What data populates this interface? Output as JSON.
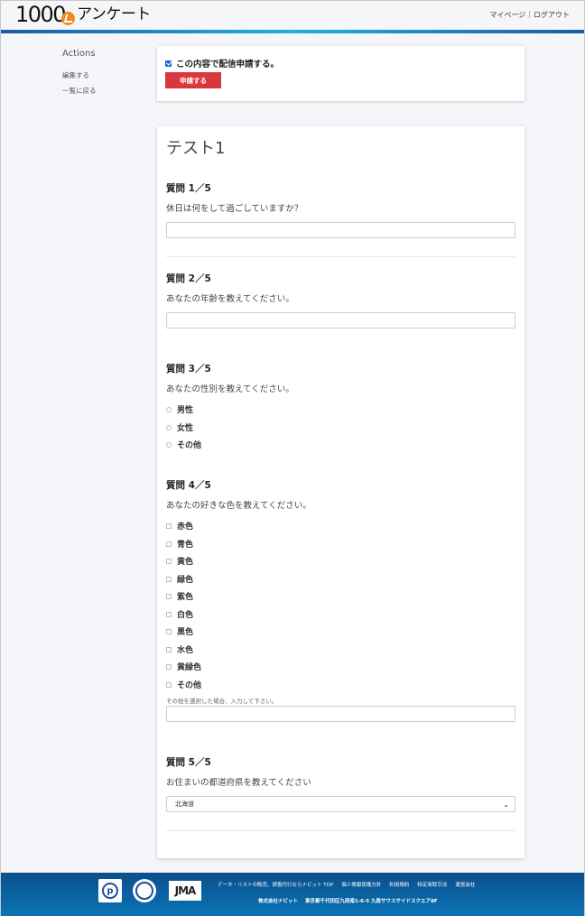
{
  "header": {
    "logo_number": "1000",
    "logo_text": "アンケート",
    "nav": [
      "マイページ",
      "ログアウト"
    ],
    "nav_separator": "|"
  },
  "sidebar": {
    "title": "Actions",
    "links": [
      "編集する",
      "一覧に戻る"
    ]
  },
  "apply": {
    "checkbox_label": "この内容で配信申請する。",
    "checked": true,
    "button_label": "申請する"
  },
  "survey": {
    "title": "テスト1",
    "questions": [
      {
        "label": "質問 1／5",
        "text": "休日は何をして過ごしていますか？",
        "type": "text",
        "value": ""
      },
      {
        "label": "質問 2／5",
        "text": "あなたの年齢を教えてください。",
        "type": "text",
        "value": ""
      },
      {
        "label": "質問 3／5",
        "text": "あなたの性別を教えてください。",
        "type": "radio",
        "options": [
          "男性",
          "女性",
          "その他"
        ]
      },
      {
        "label": "質問 4／5",
        "text": "あなたの好きな色を教えてください。",
        "type": "checkbox",
        "options": [
          "赤色",
          "青色",
          "黄色",
          "緑色",
          "紫色",
          "白色",
          "黒色",
          "水色",
          "黄緑色",
          "その他"
        ],
        "other_hint": "その他を選択した場合、入力して下さい。",
        "other_value": ""
      },
      {
        "label": "質問 5／5",
        "text": "お住まいの都道府県を教えてください",
        "type": "select",
        "selected": "北海道"
      }
    ]
  },
  "footer": {
    "badges": [
      "privacy-mark-icon",
      "certification-seal-icon",
      "jma-logo-icon"
    ],
    "badge3_text": "JMA",
    "links": [
      "データ・リストの販売、調査代行ならナビット TOP",
      "個人情報保護方針",
      "利用規約",
      "特定商取引法",
      "運営会社"
    ],
    "company": [
      "株式会社ナビット",
      "東京都千代田区九段南1-6-5 九段サウスサイドスクエア8F"
    ]
  },
  "colors": {
    "accent_red": "#d9363e",
    "header_line": "#1fb3d6",
    "footer_bg": "#0a74b5",
    "logo_orange": "#f08a1c"
  }
}
